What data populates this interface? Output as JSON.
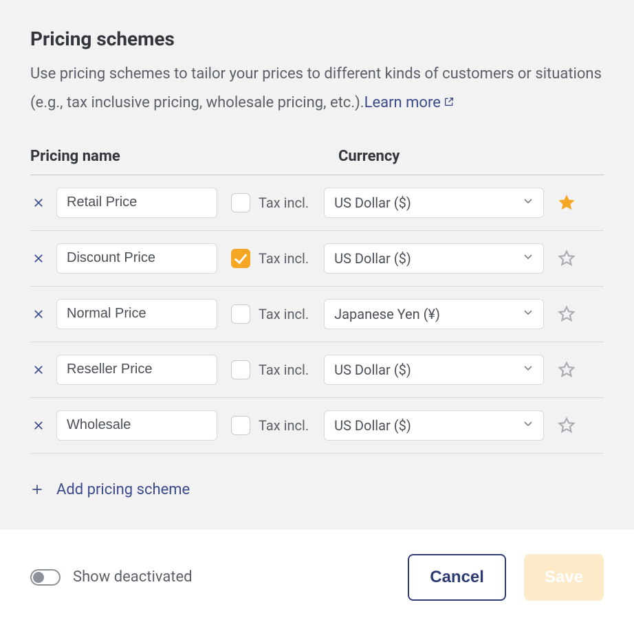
{
  "header": {
    "title": "Pricing schemes",
    "description": "Use pricing schemes to tailor your prices to different kinds of customers or situations (e.g., tax inclusive pricing, wholesale pricing, etc.).",
    "learn_more": "Learn more"
  },
  "columns": {
    "name": "Pricing name",
    "currency": "Currency"
  },
  "tax_label": "Tax incl.",
  "rows": [
    {
      "name": "Retail Price",
      "tax_incl": false,
      "currency": "US Dollar ($)",
      "starred": true
    },
    {
      "name": "Discount Price",
      "tax_incl": true,
      "currency": "US Dollar ($)",
      "starred": false
    },
    {
      "name": "Normal Price",
      "tax_incl": false,
      "currency": "Japanese Yen (¥)",
      "starred": false
    },
    {
      "name": "Reseller Price",
      "tax_incl": false,
      "currency": "US Dollar ($)",
      "starred": false
    },
    {
      "name": "Wholesale",
      "tax_incl": false,
      "currency": "US Dollar ($)",
      "starred": false
    }
  ],
  "add_label": "Add pricing scheme",
  "footer": {
    "toggle_label": "Show deactivated",
    "toggle_on": false,
    "cancel": "Cancel",
    "save": "Save"
  },
  "colors": {
    "accent_orange": "#f5a623",
    "accent_blue": "#3a4a8a"
  }
}
